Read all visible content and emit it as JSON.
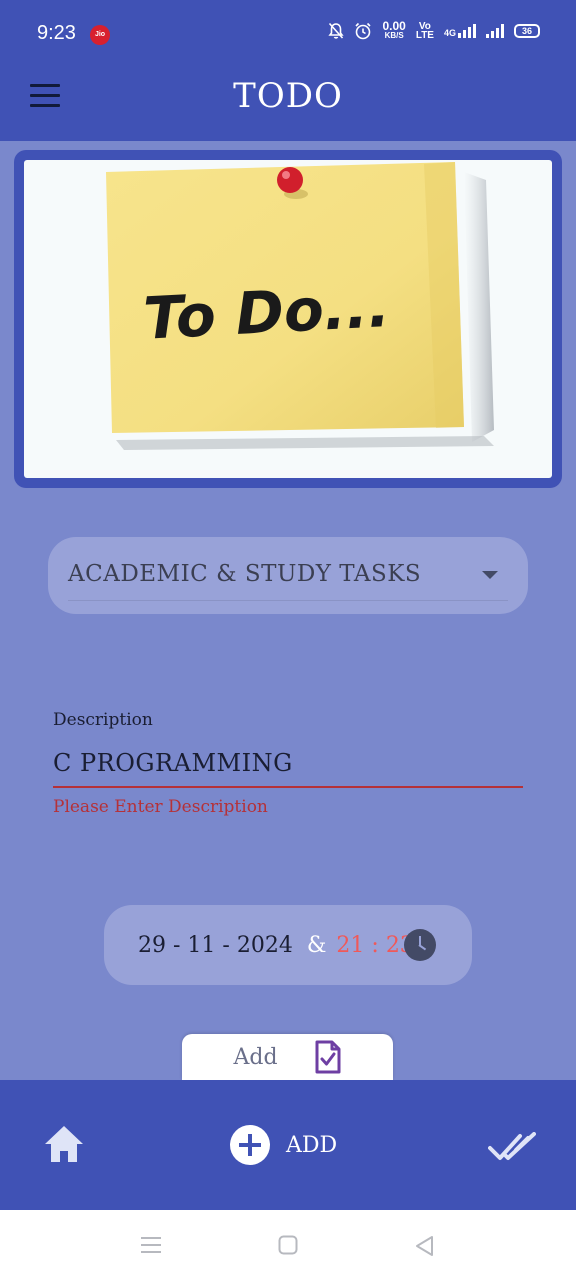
{
  "status_bar": {
    "time": "9:23",
    "carrier_badge": "Jio",
    "data_speed_value": "0.00",
    "data_speed_unit": "KB/S",
    "volte_top": "Vo",
    "volte_bottom": "LTE",
    "network_type": "4G",
    "battery": "36",
    "icons": [
      "mute-bell-icon",
      "alarm-clock-icon",
      "signal-icon",
      "battery-icon"
    ]
  },
  "app_bar": {
    "title": "TODO",
    "menu_icon": "hamburger-menu-icon"
  },
  "hero": {
    "note_text": "To Do..."
  },
  "form": {
    "category": {
      "selected": "ACADEMIC & STUDY TASKS"
    },
    "description": {
      "label": "Description",
      "value": "C PROGRAMMING",
      "error": "Please Enter Description"
    },
    "datetime": {
      "date": "29 - 11 - 2024",
      "separator": "&",
      "time": "21 : 23"
    },
    "add_button": {
      "label": "Add",
      "icon": "document-check-icon"
    }
  },
  "bottom_nav": {
    "home_icon": "home-icon",
    "add_label": "ADD",
    "add_icon": "plus-circle-icon",
    "done_icon": "double-check-icon"
  },
  "system_nav": {
    "icons": [
      "recent-apps-icon",
      "home-square-icon",
      "back-triangle-icon"
    ]
  },
  "colors": {
    "primary": "#4052b5",
    "background": "#7a88cc",
    "pill": "#98a2d8",
    "error": "#b53138",
    "time_accent": "#ef5959"
  }
}
